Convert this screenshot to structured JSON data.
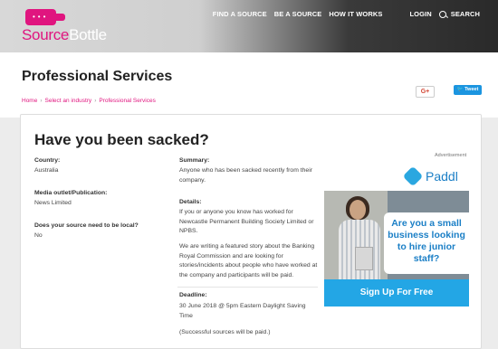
{
  "header": {
    "logo_part1": "Source",
    "logo_part2": "Bottle",
    "nav": [
      "FIND A SOURCE",
      "BE A SOURCE",
      "HOW IT WORKS"
    ],
    "login": "LOGIN",
    "search": "SEARCH"
  },
  "page": {
    "title": "Professional Services",
    "breadcrumbs": [
      "Home",
      "Select an industry",
      "Professional Services"
    ],
    "breadcrumb_sep": "›",
    "gplus": "G+",
    "tweet": "Tweet"
  },
  "card": {
    "title": "Have you been sacked?",
    "country_label": "Country:",
    "country_value": "Australia",
    "outlet_label": "Media outlet/Publication:",
    "outlet_value": "News Limited",
    "local_label": "Does your source need to be local?",
    "local_value": "No",
    "summary_label": "Summary:",
    "summary_text": "Anyone who has been sacked recently from their company.",
    "details_label": "Details:",
    "details_p1": "If you or anyone you know has worked for Newcastle Permanent Building Society Limited or NPBS.",
    "details_p2": "We are writing a featured story about the Banking Royal Commission and are looking for stories/incidents about people who have worked at the company and participants will be paid.",
    "deadline_label": "Deadline:",
    "deadline_value": "30 June 2018 @ 5pm Eastern Daylight Saving Time",
    "paid_note": "(Successful sources will be paid.)"
  },
  "ad": {
    "label": "Advertisement",
    "brand": "Paddl",
    "headline": "Are you a small business looking to hire junior staff?",
    "cta": "Sign Up For Free"
  }
}
